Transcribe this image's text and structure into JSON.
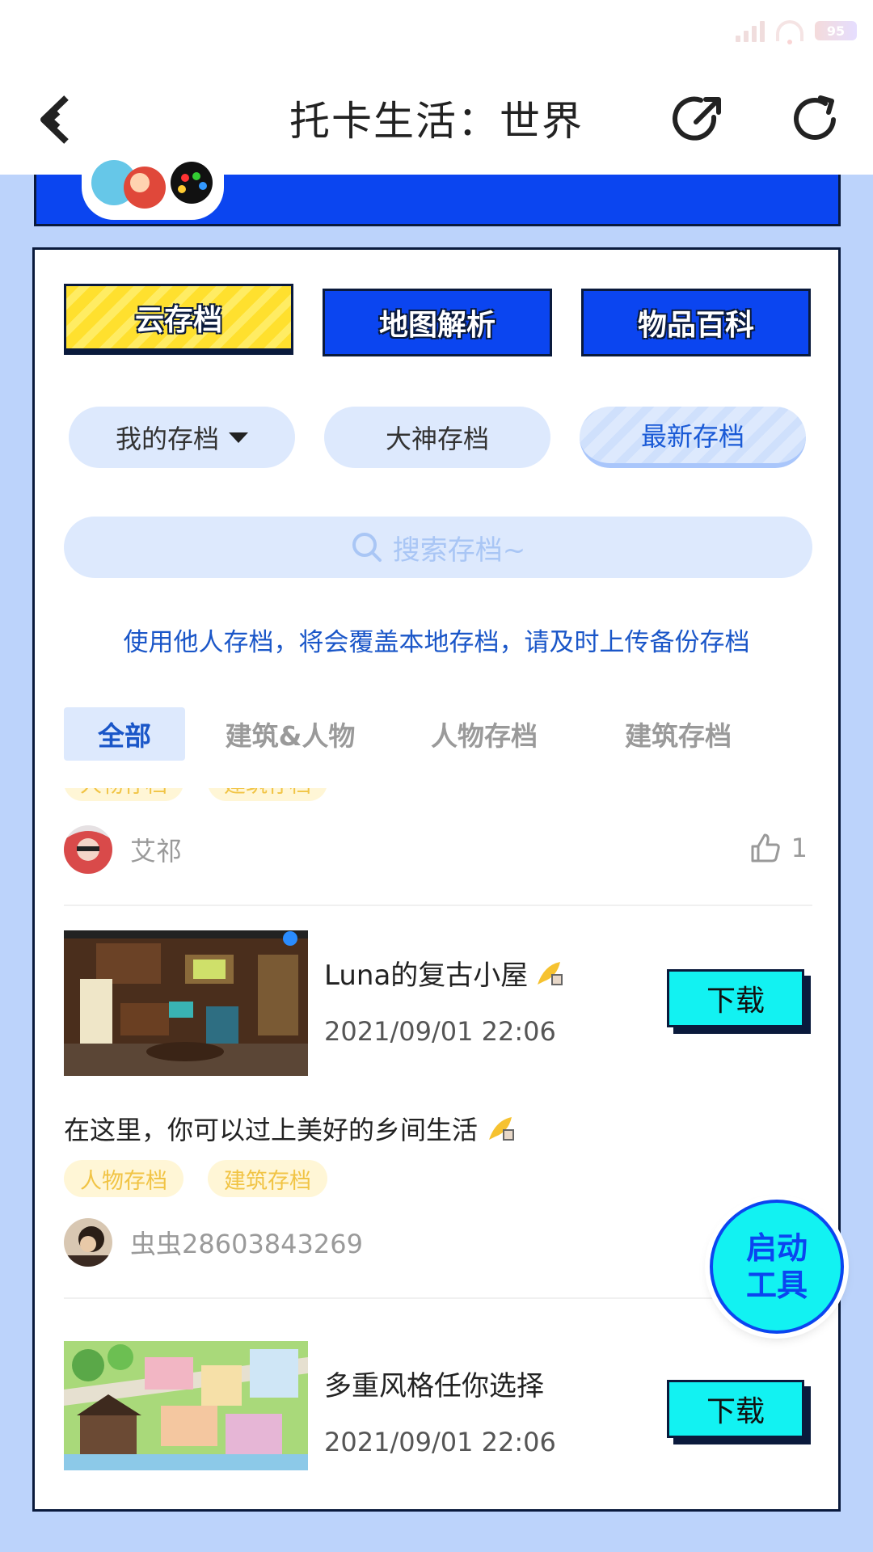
{
  "status": {
    "battery": "95"
  },
  "header": {
    "title": "托卡生活：世界"
  },
  "top_buttons": [
    "云存档",
    "地图解析",
    "物品百科"
  ],
  "filter_pills": {
    "mine": "我的存档",
    "masters": "大神存档",
    "latest": "最新存档"
  },
  "search": {
    "placeholder": "搜索存档~"
  },
  "notice": "使用他人存档，将会覆盖本地存档，请及时上传备份存档",
  "tabs": [
    "全部",
    "建筑&人物",
    "人物存档",
    "建筑存档"
  ],
  "partial_tags": [
    "人物存档",
    "建筑存档"
  ],
  "first_author": {
    "name": "艾祁",
    "likes": "1"
  },
  "items": [
    {
      "title": "Luna的复古小屋",
      "date": "2021/09/01 22:06",
      "download": "下载",
      "desc": "在这里，你可以过上美好的乡间生活",
      "tags": [
        "人物存档",
        "建筑存档"
      ],
      "author": "虫虫28603843269"
    },
    {
      "title": "多重风格任你选择",
      "date": "2021/09/01 22:06",
      "download": "下载"
    }
  ],
  "fab": {
    "line1": "启动",
    "line2": "工具"
  },
  "colors": {
    "accent_blue": "#0b45f0",
    "cyan_button": "#12f2f2",
    "yellow_tab": "#ffe02e",
    "page_bg": "#bcd3fb",
    "tag_yellow": "#f1c445"
  }
}
